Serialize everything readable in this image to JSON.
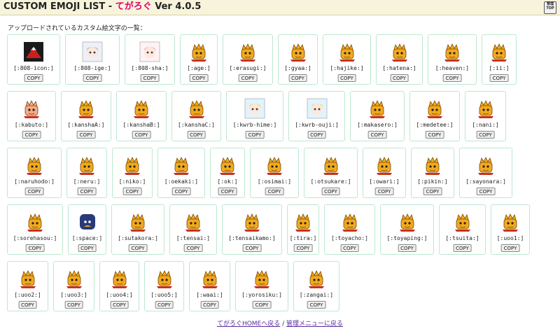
{
  "header": {
    "title": "CUSTOM EMOJI LIST - ",
    "app_name": "てがろぐ",
    "version": "Ver 4.0.5",
    "admin_button_label": "管理TOP"
  },
  "intro_text": "アップロードされているカスタム絵文字の一覧：",
  "copy_label": "COPY",
  "rows": [
    [
      {
        "code": "[:808-icon:]",
        "icon": "mountain-avatar-icon"
      },
      {
        "code": "[:808-ige:]",
        "icon": "girl-avatar-icon"
      },
      {
        "code": "[:808-sha:]",
        "icon": "pink-girl-avatar-icon"
      },
      {
        "code": "[:age:]",
        "icon": "yellow-mascot-icon"
      },
      {
        "code": "[:erasugi:]",
        "icon": "yellow-mascot-icon"
      },
      {
        "code": "[:gyaa:]",
        "icon": "yellow-mascot-icon"
      },
      {
        "code": "[:hajike:]",
        "icon": "yellow-mascot-icon"
      },
      {
        "code": "[:hatena:]",
        "icon": "yellow-mascot-icon"
      },
      {
        "code": "[:heaven:]",
        "icon": "yellow-mascot-icon"
      },
      {
        "code": "[:ii:]",
        "icon": "yellow-mascot-icon"
      }
    ],
    [
      {
        "code": "[:kabuto:]",
        "icon": "pink-mascot-icon"
      },
      {
        "code": "[:kanshaA:]",
        "icon": "yellow-mascot-icon"
      },
      {
        "code": "[:kanshaB:]",
        "icon": "yellow-mascot-icon"
      },
      {
        "code": "[:kanshaC:]",
        "icon": "yellow-mascot-icon"
      },
      {
        "code": "[:kwrb-hime:]",
        "icon": "princess-avatar-icon"
      },
      {
        "code": "[:kwrb-ouji:]",
        "icon": "prince-avatar-icon"
      },
      {
        "code": "[:makasero:]",
        "icon": "yellow-mascot-icon"
      },
      {
        "code": "[:medetee:]",
        "icon": "yellow-mascot-icon"
      },
      {
        "code": "[:nani:]",
        "icon": "yellow-mascot-icon"
      }
    ],
    [
      {
        "code": "[:naruhodo:]",
        "icon": "yellow-mascot-icon"
      },
      {
        "code": "[:neru:]",
        "icon": "yellow-mascot-icon"
      },
      {
        "code": "[:niko:]",
        "icon": "yellow-mascot-icon"
      },
      {
        "code": "[:oekaki:]",
        "icon": "yellow-mascot-icon"
      },
      {
        "code": "[:ok:]",
        "icon": "yellow-mascot-icon"
      },
      {
        "code": "[:osimai:]",
        "icon": "yellow-mascot-icon"
      },
      {
        "code": "[:otsukare:]",
        "icon": "yellow-mascot-icon"
      },
      {
        "code": "[:owari:]",
        "icon": "yellow-mascot-icon"
      },
      {
        "code": "[:pikin:]",
        "icon": "yellow-mascot-icon"
      },
      {
        "code": "[:sayonara:]",
        "icon": "yellow-mascot-icon"
      }
    ],
    [
      {
        "code": "[:sorehasou:]",
        "icon": "yellow-mascot-icon"
      },
      {
        "code": "[:space:]",
        "icon": "space-mascot-icon"
      },
      {
        "code": "[:sutakora:]",
        "icon": "yellow-mascot-icon"
      },
      {
        "code": "[:tensai:]",
        "icon": "yellow-mascot-icon"
      },
      {
        "code": "[:tensaikamo:]",
        "icon": "yellow-mascot-icon"
      },
      {
        "code": "[:tira:]",
        "icon": "yellow-mascot-icon"
      },
      {
        "code": "[:toyacho:]",
        "icon": "yellow-mascot-icon"
      },
      {
        "code": "[:toyaping:]",
        "icon": "yellow-mascot-icon"
      },
      {
        "code": "[:tsuita:]",
        "icon": "yellow-mascot-icon"
      },
      {
        "code": "[:uoo1:]",
        "icon": "yellow-mascot-icon"
      }
    ],
    [
      {
        "code": "[:uoo2:]",
        "icon": "yellow-mascot-icon"
      },
      {
        "code": "[:uoo3:]",
        "icon": "yellow-mascot-icon"
      },
      {
        "code": "[:uoo4:]",
        "icon": "yellow-mascot-icon"
      },
      {
        "code": "[:uoo5:]",
        "icon": "yellow-mascot-icon"
      },
      {
        "code": "[:waai:]",
        "icon": "yellow-mascot-icon"
      },
      {
        "code": "[:yorosiku:]",
        "icon": "yellow-mascot-icon"
      },
      {
        "code": "[:zangai:]",
        "icon": "yellow-mascot-icon"
      }
    ]
  ],
  "footer": {
    "home_link": "てがろぐHOMEへ戻る",
    "separator": "/",
    "admin_link": "管理メニューに戻る"
  },
  "colors": {
    "header_bg": "#f8f4dc",
    "app_name": "#e0006c",
    "card_border": "#bde8cf",
    "mascot": "#f2a91e",
    "link": "#5a2ca0"
  }
}
